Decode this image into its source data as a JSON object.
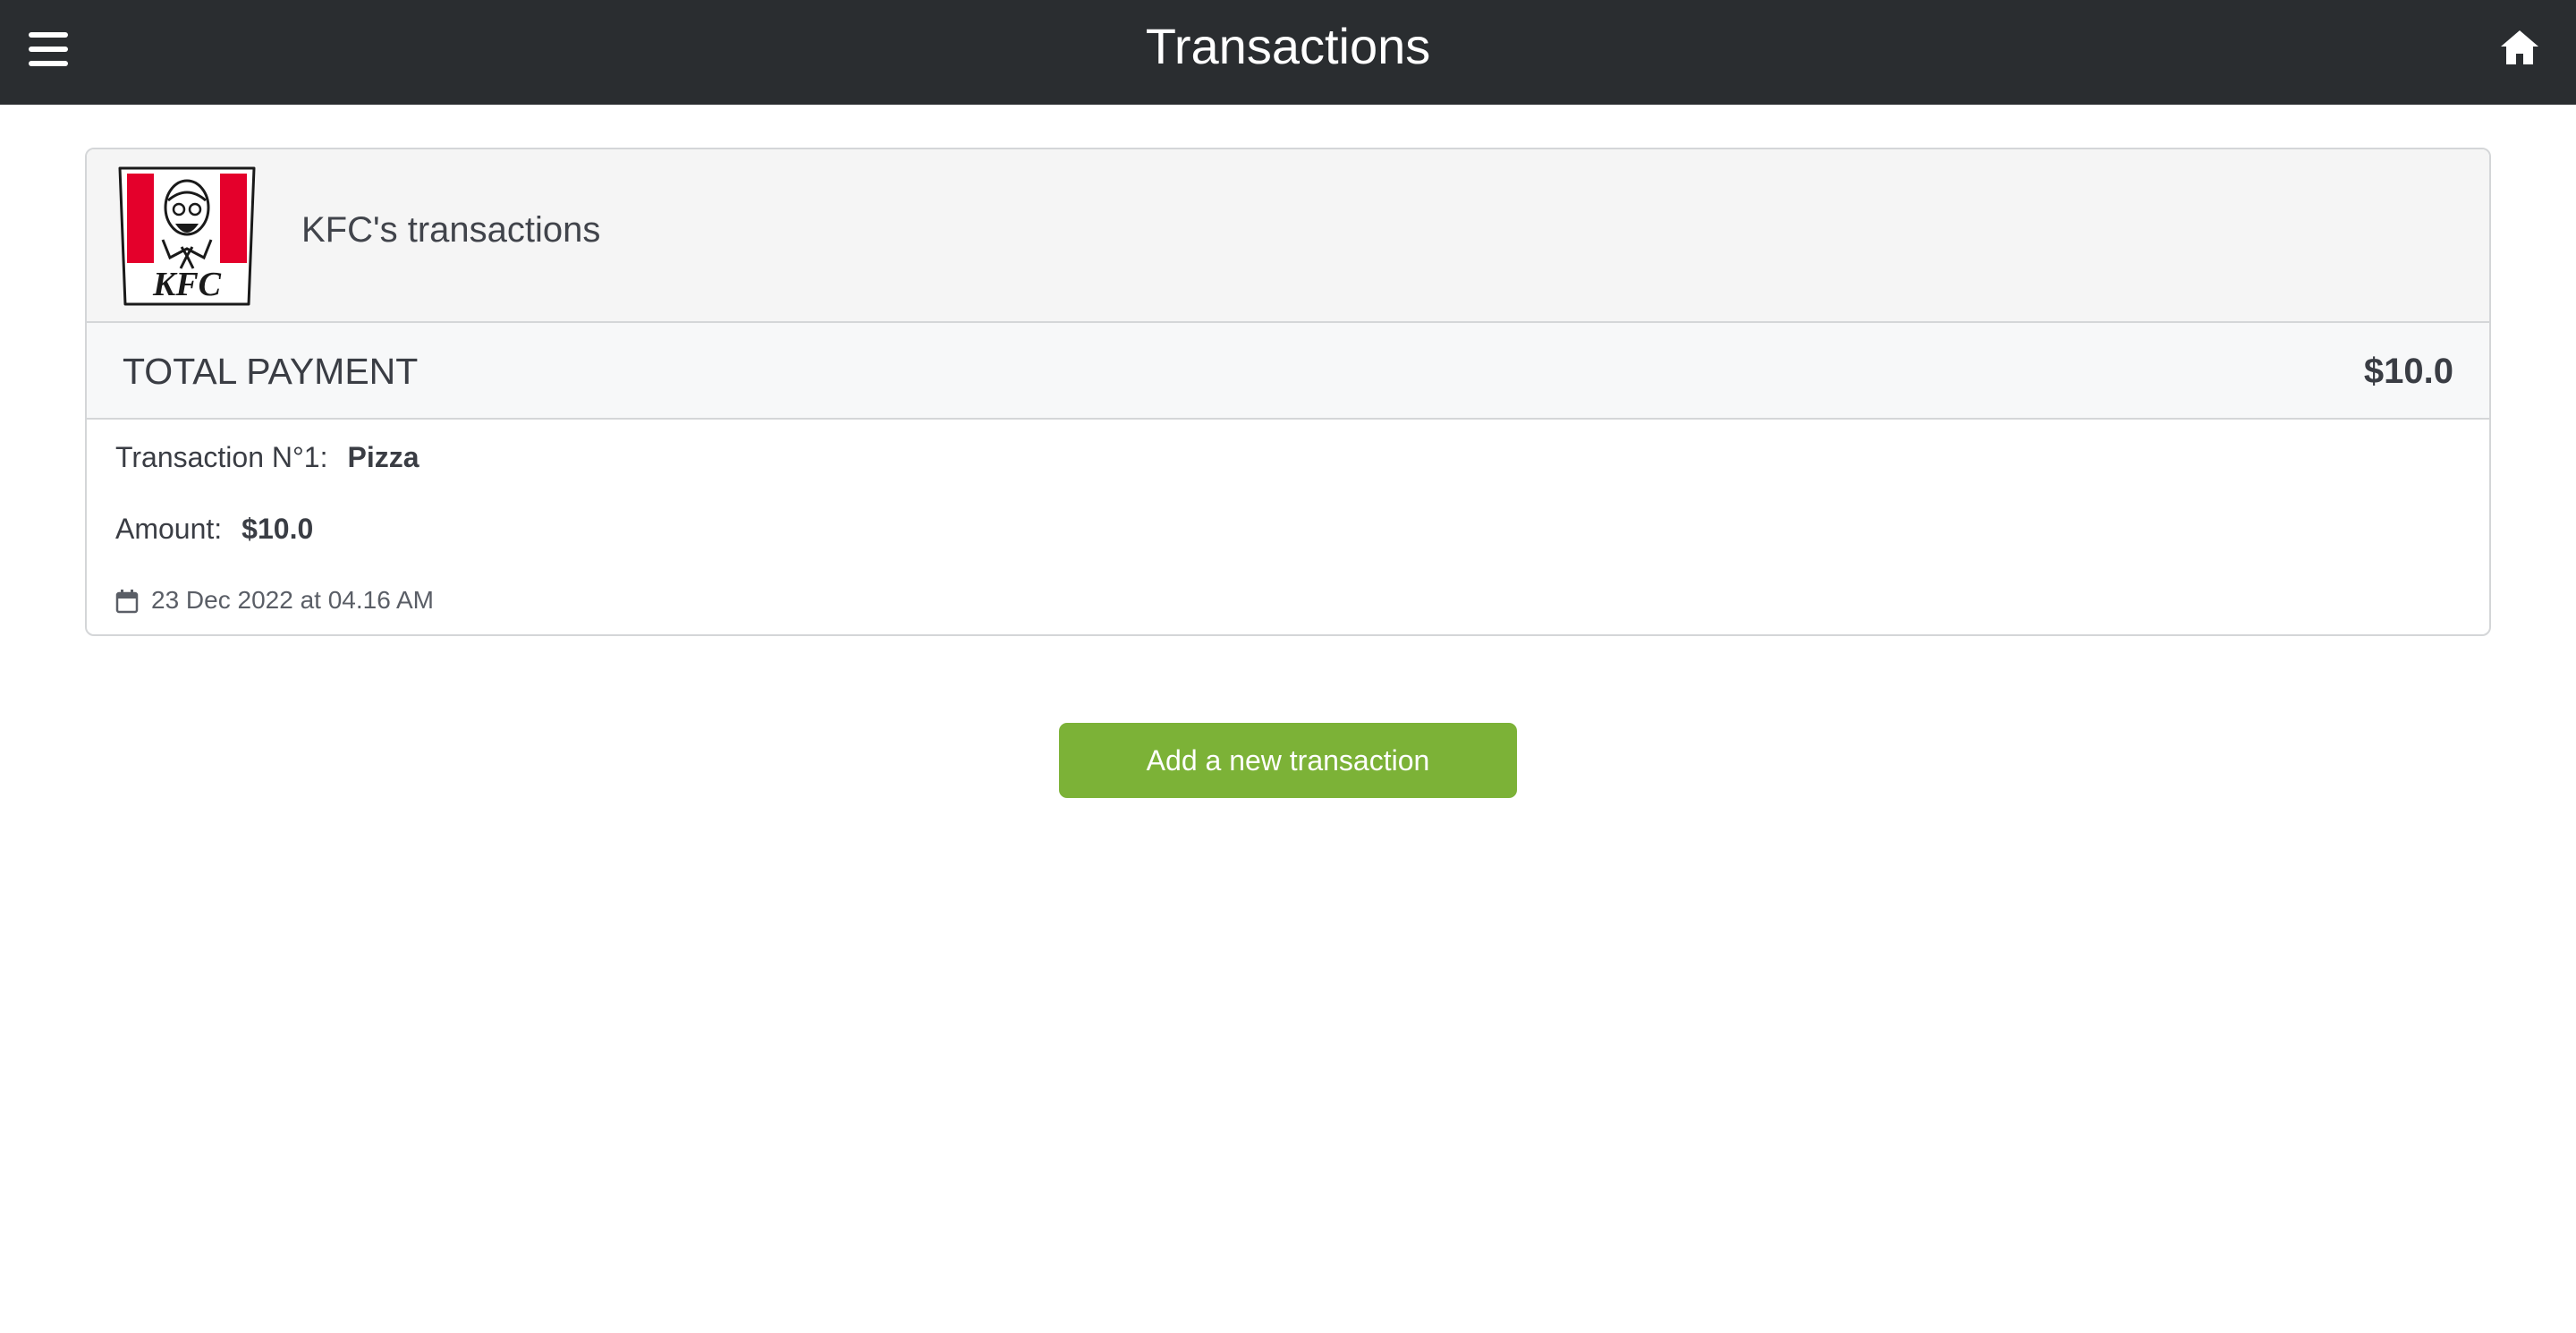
{
  "header": {
    "title": "Transactions",
    "menu_icon": "hamburger-menu-icon",
    "home_icon": "home-icon"
  },
  "merchant": {
    "name": "KFC",
    "logo_text": "KFC",
    "card_title": "KFC's transactions"
  },
  "summary": {
    "total_label": "TOTAL PAYMENT",
    "total_value": "$10.0"
  },
  "transactions": [
    {
      "label": "Transaction N°1:",
      "item": "Pizza",
      "amount_label": "Amount:",
      "amount": "$10.0",
      "date": "23 Dec 2022 at 04.16 AM",
      "date_icon": "calendar-icon"
    }
  ],
  "actions": {
    "add_label": "Add a new transaction"
  },
  "colors": {
    "navbar": "#2a2d30",
    "button": "#7cb237",
    "kfc_red": "#e4002b"
  }
}
